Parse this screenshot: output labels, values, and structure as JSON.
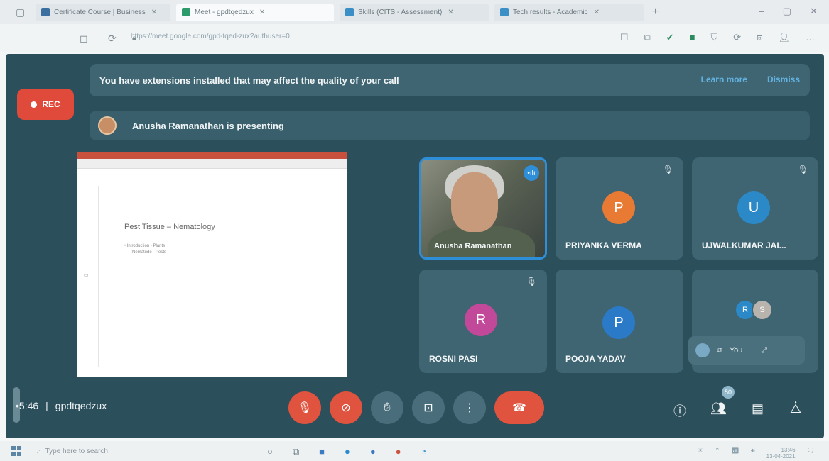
{
  "browser": {
    "tabs": [
      {
        "label": "Certificate Course | Business",
        "icon": "doc-icon",
        "color": "#3b6fa0"
      },
      {
        "label": "Meet - gpdtqedzux",
        "icon": "meet-icon",
        "color": "#2c9a6a",
        "active": true
      },
      {
        "label": "Skills (CITS - Assessment)",
        "icon": "page-icon",
        "color": "#3b8fc7"
      },
      {
        "label": "Tech results - Academic",
        "icon": "page-icon",
        "color": "#3b8fc7"
      }
    ],
    "new_tab": "+",
    "url": "https://meet.google.com/gpd-tqed-zux?authuser=0"
  },
  "meet": {
    "extension_banner": {
      "text": "You have extensions installed that may affect the quality of your call",
      "learn_more": "Learn more",
      "dismiss": "Dismiss"
    },
    "rec_label": "REC",
    "presenting_text": "Anusha Ramanathan is presenting",
    "slide": {
      "heading": "Pest Tissue – Nematology",
      "bullet1": "• Introduction - Plants",
      "bullet2": "– Nematode - Pests"
    },
    "participants": [
      {
        "name": "Anusha Ramanathan",
        "type": "video"
      },
      {
        "name": "PRIYANKA VERMA",
        "initial": "P",
        "color": "#e97a33"
      },
      {
        "name": "UJWALKUMAR JAI...",
        "initial": "U",
        "color": "#2b89c7"
      },
      {
        "name": "ROSNI PASI",
        "initial": "R",
        "color": "#c2489a"
      },
      {
        "name": "POOJA YADAV",
        "initial": "P",
        "color": "#2b7ac7"
      }
    ],
    "others": [
      {
        "initial": "R",
        "color": "#2b89c7"
      },
      {
        "initial": "S",
        "color": "#b9b3ad"
      }
    ],
    "self_view_label": "You",
    "meeting_time": "•5:46",
    "meeting_code": "gpdtqedzux",
    "participant_count": "50",
    "end_color": "#e0533e"
  },
  "taskbar": {
    "search_placeholder": "Type here to search",
    "time": "13:46",
    "date": "13-04-2021"
  }
}
